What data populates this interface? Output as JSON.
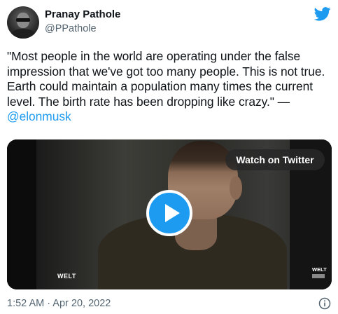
{
  "author": {
    "name": "Pranay Pathole",
    "handle": "@PPathole"
  },
  "tweet": {
    "text_before": "\"Most people in the world are operating under the false impression that we've got too many people. This is not true. Earth could maintain a population many times the current level. The birth rate has been dropping like crazy.\" — ",
    "mention": "@elonmusk"
  },
  "media": {
    "watch_label": "Watch on Twitter",
    "watermark_left": "WELT",
    "watermark_right": "WELT"
  },
  "footer": {
    "timestamp": "1:52 AM · Apr 20, 2022"
  },
  "icons": {
    "bird": "twitter-bird-icon",
    "play": "play-icon",
    "info": "info-icon"
  },
  "colors": {
    "accent": "#1d9bf0",
    "secondary_text": "#536471",
    "primary_text": "#0f1419"
  }
}
